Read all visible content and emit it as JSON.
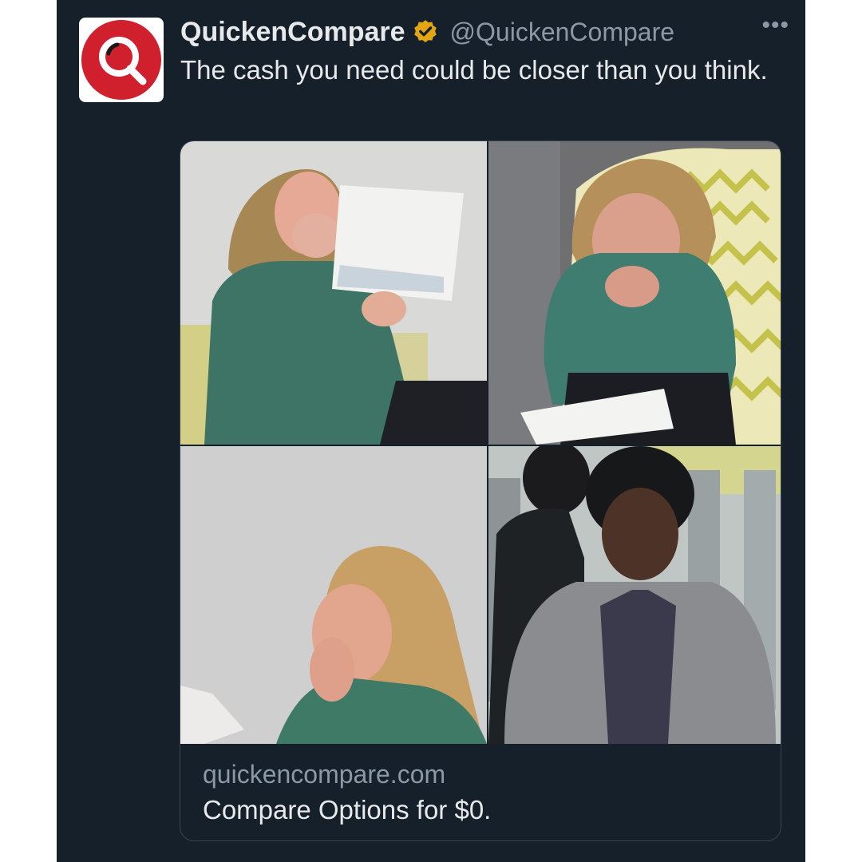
{
  "tweet": {
    "display_name": "QuickenCompare",
    "handle": "@QuickenCompare",
    "verified": true,
    "text": "The cash you need could be closer than you think.",
    "more_icon": "more-horizontal-icon",
    "avatar_icon": "magnifier-logo-icon"
  },
  "card": {
    "domain": "quickencompare.com",
    "title": "Compare Options for $0.",
    "photos": [
      "woman in green sweater covering mouth while reading a letter",
      "woman in green sweater looking down at paper in patterned chair",
      "woman in green sweater gasping with hand over mouth",
      "woman in grey cardigan looking disappointed, man in background"
    ]
  },
  "colors": {
    "background": "#15202b",
    "text": "#e7e9ea",
    "secondary_text": "#8b98a5",
    "border": "#38444d",
    "brand_red": "#d0202e",
    "verified_gold": "#e2a615"
  }
}
